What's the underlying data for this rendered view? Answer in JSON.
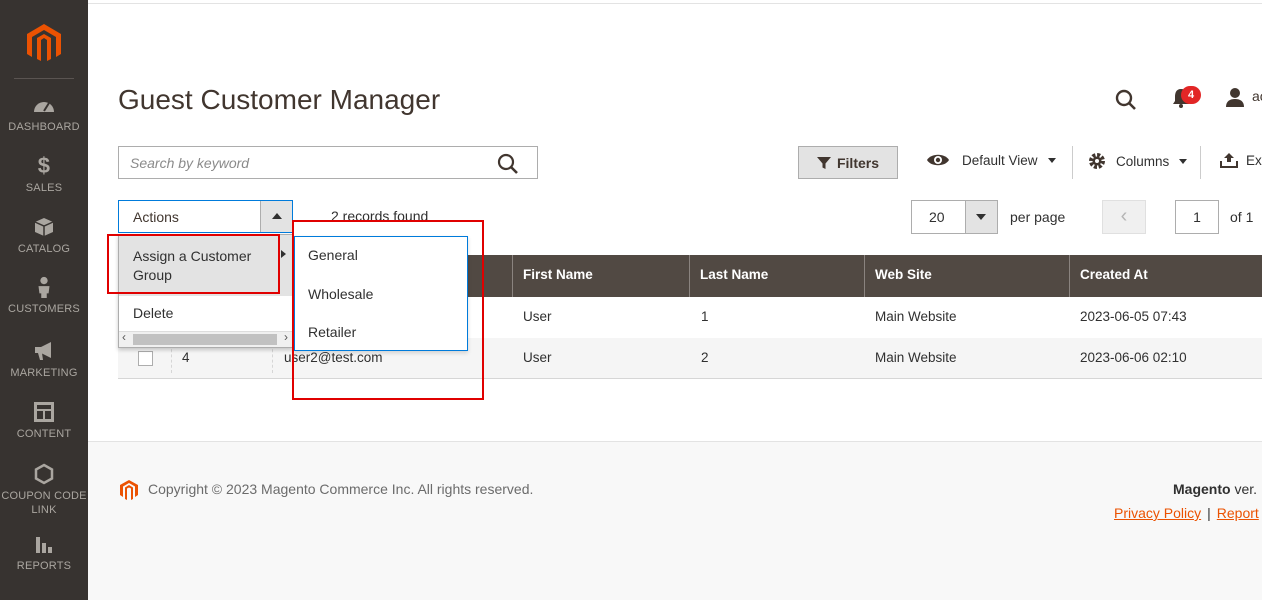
{
  "sidebar": {
    "items": [
      {
        "label": "DASHBOARD",
        "icon": "dashboard-icon"
      },
      {
        "label": "SALES",
        "icon": "dollar-icon"
      },
      {
        "label": "CATALOG",
        "icon": "box-icon"
      },
      {
        "label": "CUSTOMERS",
        "icon": "person-icon"
      },
      {
        "label": "MARKETING",
        "icon": "megaphone-icon"
      },
      {
        "label": "CONTENT",
        "icon": "layout-icon"
      },
      {
        "label": "COUPON CODE",
        "label2": "LINK",
        "icon": "hexagon-icon"
      },
      {
        "label": "REPORTS",
        "icon": "bar-chart-icon"
      }
    ]
  },
  "header": {
    "title": "Guest Customer Manager",
    "notification_count": "4",
    "user_name": "ac"
  },
  "toolbar": {
    "search_placeholder": "Search by keyword",
    "filters_label": "Filters",
    "view_label": "Default View",
    "columns_label": "Columns",
    "export_label": "Exp"
  },
  "actions": {
    "label": "Actions",
    "menu": [
      "Assign a Customer Group",
      "Delete"
    ],
    "submenu": [
      "General",
      "Wholesale",
      "Retailer"
    ]
  },
  "records_text": "2 records found",
  "pagination": {
    "per_page_value": "20",
    "per_page_label": "per page",
    "prev": "‹",
    "page": "1",
    "of_total": "of 1"
  },
  "table": {
    "columns": [
      "First Name",
      "Last Name",
      "Web Site",
      "Created At"
    ],
    "rows": [
      {
        "id": "",
        "email": "",
        "first_name": "User",
        "last_name": "1",
        "website": "Main Website",
        "created_at": "2023-06-05 07:43"
      },
      {
        "id": "4",
        "email": "user2@test.com",
        "first_name": "User",
        "last_name": "2",
        "website": "Main Website",
        "created_at": "2023-06-06 02:10"
      }
    ]
  },
  "footer": {
    "copyright": "Copyright © 2023 Magento Commerce Inc. All rights reserved.",
    "brand": "Magento",
    "version": "ver.",
    "privacy": "Privacy Policy",
    "separator": "|",
    "report": "Report"
  },
  "colors": {
    "sidebar_bg": "#373330",
    "accent": "#eb5202",
    "table_header": "#514943",
    "highlight_box": "#e00000",
    "badge": "#e22626"
  }
}
